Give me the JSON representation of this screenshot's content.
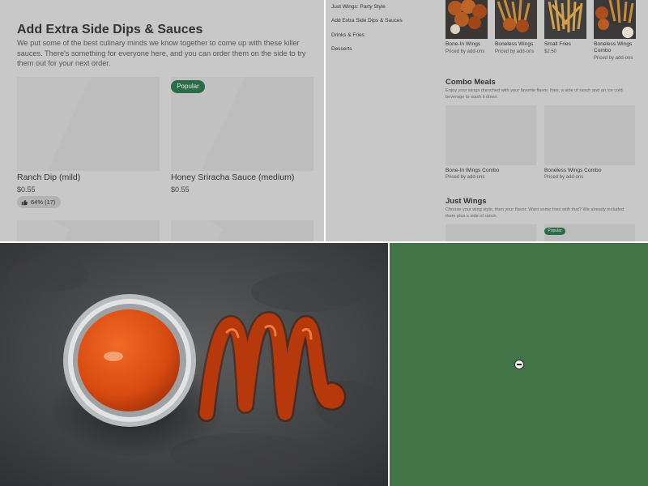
{
  "section": {
    "title": "Add Extra Side Dips & Sauces",
    "description": "We put some of the best culinary minds we know together to come up with these killer sauces. There's something for everyone here, and you can order them on the side to try them out for your next order.",
    "items": [
      {
        "name": "Ranch Dip (mild)",
        "price": "$0.55",
        "rating": "64% (17)"
      },
      {
        "name": "Honey Sriracha Sauce (medium)",
        "price": "$0.55",
        "badge": "Popular"
      }
    ]
  },
  "menu": {
    "nav": [
      "Just Wings: Party Style",
      "Add Extra Side Dips & Sauces",
      "Drinks & Fries",
      "Desserts"
    ],
    "top_items": [
      {
        "name": "Bone-In Wings",
        "price": "Priced by add-ons"
      },
      {
        "name": "Boneless Wings",
        "price": "Priced by add-ons"
      },
      {
        "name": "Small Fries",
        "price": "$2.50"
      },
      {
        "name": "Boneless Wings Combo",
        "price": "Priced by add-ons"
      }
    ],
    "combo": {
      "title": "Combo Meals",
      "description": "Enjoy your wings drenched with your favorite flavor, fries, a side of ranch and an ice cold beverage to wash it down.",
      "items": [
        {
          "name": "Bone-In Wings Combo",
          "price": "Priced by add-ons"
        },
        {
          "name": "Boneless Wings Combo",
          "price": "Priced by add-ons"
        }
      ]
    },
    "just_wings": {
      "title": "Just Wings",
      "description": "Choose your wing style, then your flavor. Want some fries with that? We already included them plus a side of ranch.",
      "badge": "Popular"
    }
  },
  "colors": {
    "overlay_gray": "#c8c8c8",
    "badge_green": "#2a6b48",
    "loading_panel_green": "#437447"
  },
  "icons": {
    "rating": "thumbs-up-icon",
    "loading": "loading-spinner-icon"
  }
}
